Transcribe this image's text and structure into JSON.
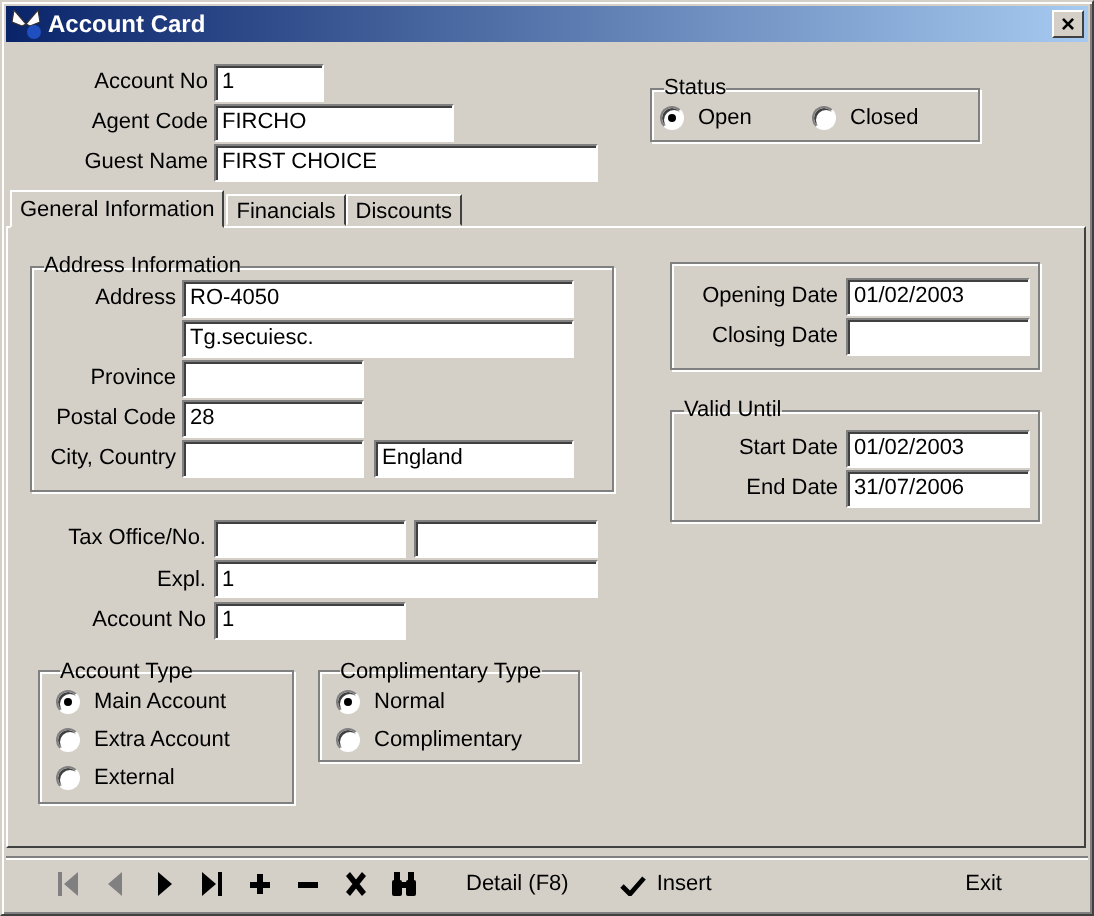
{
  "window": {
    "title": "Account Card",
    "close": "×"
  },
  "top_fields": [
    {
      "label": "Account No",
      "value": "1",
      "kind": "short"
    },
    {
      "label": "Agent Code",
      "value": "FIRCHO",
      "kind": "medium"
    },
    {
      "label": "Guest Name",
      "value": "FIRST CHOICE",
      "kind": "long"
    }
  ],
  "status": {
    "title": "Status",
    "options": [
      {
        "label": "Open",
        "selected": true
      },
      {
        "label": "Closed",
        "selected": false
      }
    ]
  },
  "tabs": [
    {
      "label": "General Information",
      "selected": true
    },
    {
      "label": "Financials",
      "selected": false
    },
    {
      "label": "Discounts",
      "selected": false
    }
  ],
  "address": {
    "title": "Address Information",
    "rows": [
      {
        "label": "Address",
        "value": "RO-4050",
        "kind": "wide"
      },
      {
        "value": "Tg.secuiesc.",
        "kind": "wide"
      },
      {
        "label": "Province",
        "kind": "short"
      },
      {
        "label": "Postal Code",
        "value": "28",
        "kind": "short"
      },
      {
        "label": "City, Country",
        "value_2": "England",
        "kind": "pair"
      }
    ]
  },
  "tax_rows": [
    {
      "label": "Tax Office/No.",
      "kind": "pair"
    },
    {
      "label": "Expl.",
      "value": "1",
      "kind": "wide"
    },
    {
      "label": "Account No",
      "value": "1",
      "kind": "short"
    }
  ],
  "account_type": {
    "title": "Account Type",
    "options": [
      {
        "label": "Main Account",
        "selected": true
      },
      {
        "label": "Extra Account",
        "selected": false
      },
      {
        "label": "External",
        "selected": false
      }
    ]
  },
  "complimentary_type": {
    "title": "Complimentary Type",
    "options": [
      {
        "label": "Normal",
        "selected": true
      },
      {
        "label": "Complimentary",
        "selected": false
      }
    ]
  },
  "dates": {
    "rows": [
      {
        "label": "Opening Date",
        "value": "01/02/2003"
      },
      {
        "label": "Closing Date"
      }
    ]
  },
  "valid_until": {
    "title": "Valid Until",
    "rows": [
      {
        "label": "Start Date",
        "value": "01/02/2003"
      },
      {
        "label": "End Date",
        "value": "31/07/2006"
      }
    ]
  },
  "toolbar": {
    "nav": [
      {
        "kind": "first",
        "disabled": true
      },
      {
        "kind": "prev",
        "disabled": true
      },
      {
        "kind": "next",
        "disabled": false
      },
      {
        "kind": "last",
        "disabled": false
      },
      {
        "kind": "add",
        "disabled": false
      },
      {
        "kind": "remove",
        "disabled": false
      },
      {
        "kind": "cancel",
        "disabled": false
      },
      {
        "kind": "find",
        "disabled": false
      }
    ],
    "detail": "Detail (F8)",
    "insert": "Insert",
    "exit": "Exit"
  }
}
